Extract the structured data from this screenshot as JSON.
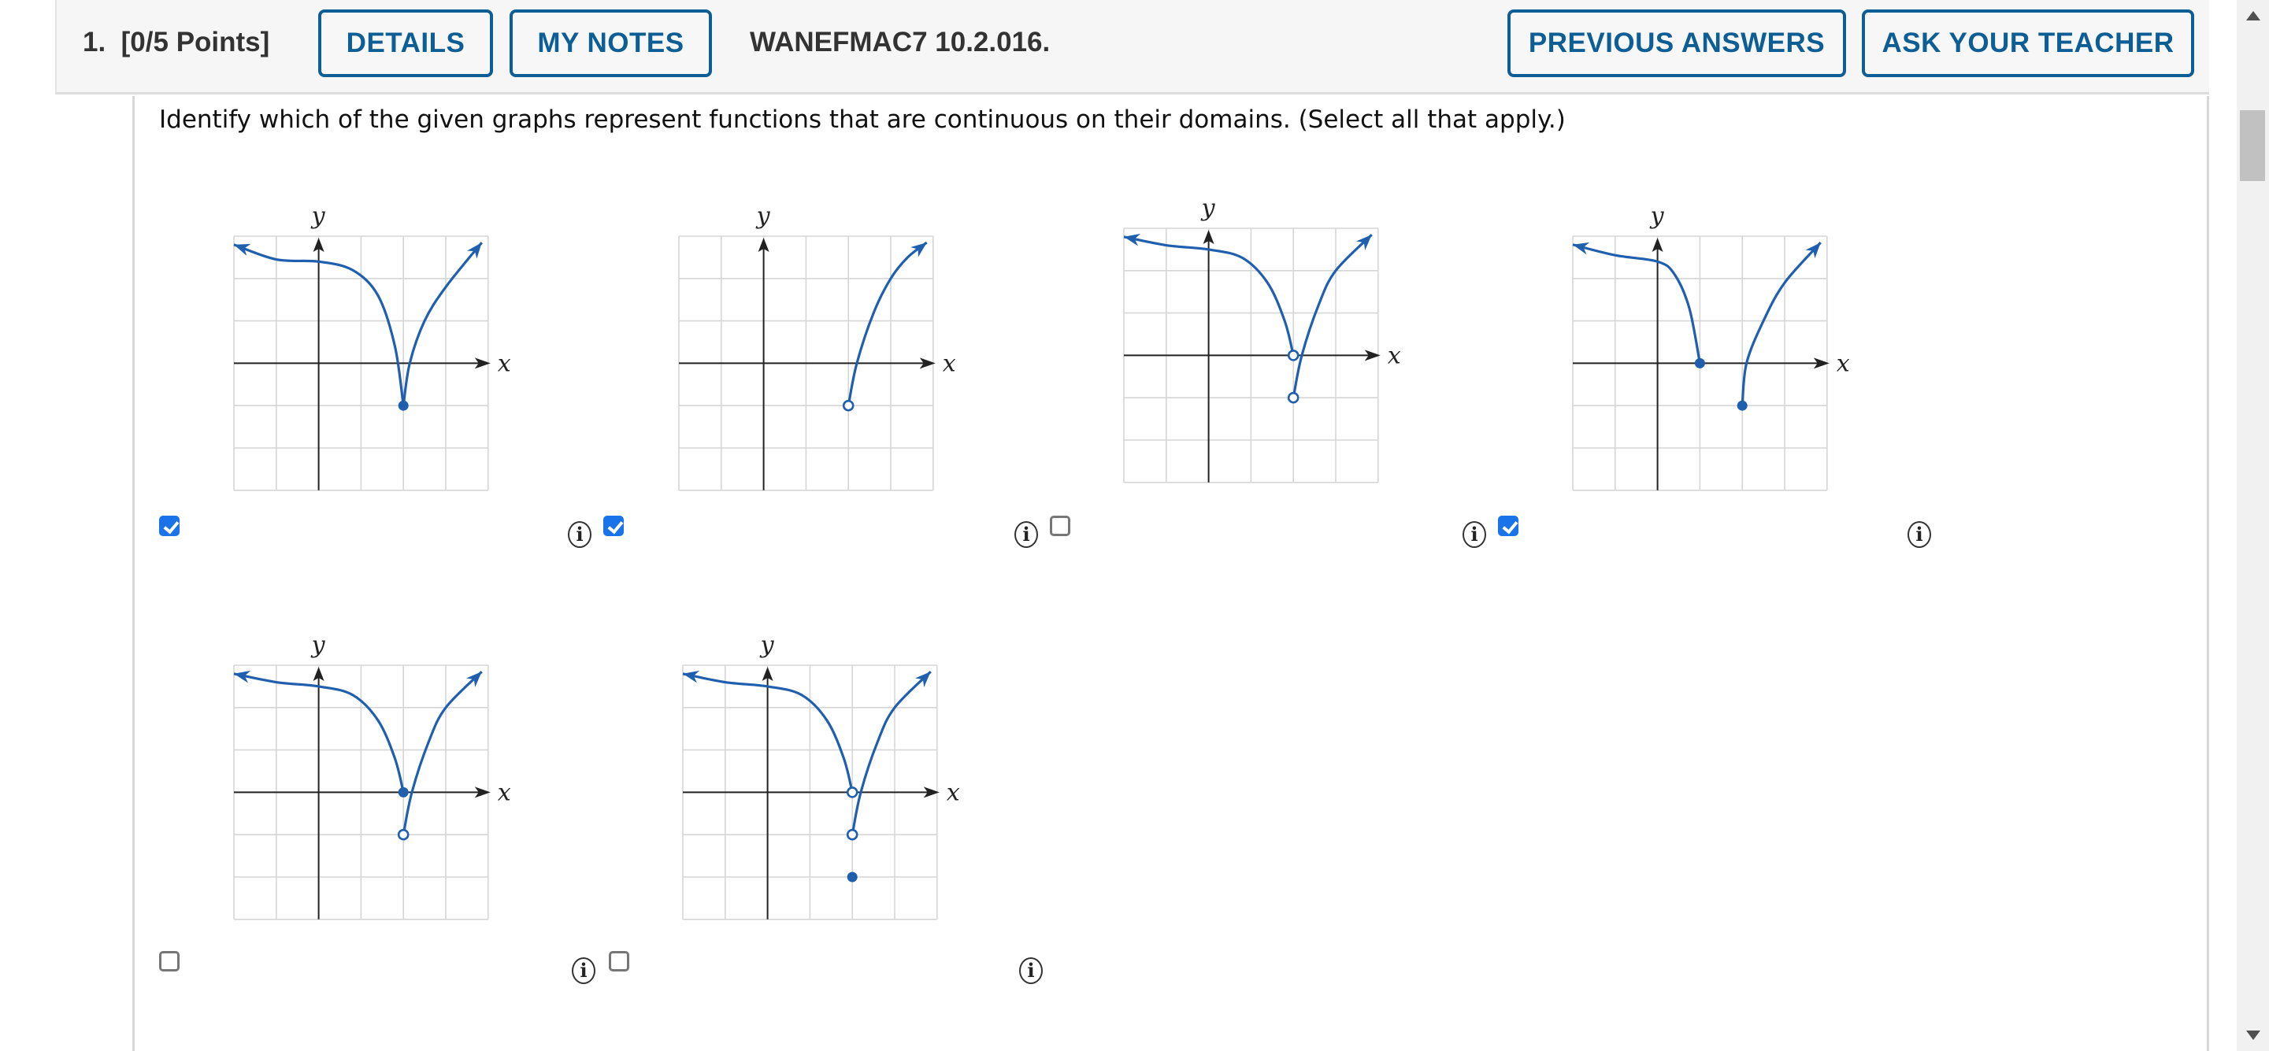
{
  "header": {
    "question_number": "1.",
    "points": "[0/5 Points]",
    "details_label": "DETAILS",
    "my_notes_label": "MY NOTES",
    "problem_code": "WANEFMAC7 10.2.016.",
    "previous_answers_label": "PREVIOUS ANSWERS",
    "ask_teacher_label": "ASK YOUR TEACHER"
  },
  "question": {
    "text": "Identify which of the given graphs represent functions that are continuous on their domains. (Select all that apply.)"
  },
  "colors": {
    "accent": "#0d5e94",
    "curve": "#1f5fae",
    "checkbox_checked": "#1a73e8",
    "grid": "#d6d6d6",
    "axis": "#222222",
    "header_bg": "#f6f6f6"
  },
  "info_icon": "info-circle-icon",
  "chart_data": [
    {
      "type": "line",
      "id": "graph-1",
      "xlabel": "x",
      "ylabel": "y",
      "xlim": [
        -2,
        4
      ],
      "ylim": [
        -3,
        3
      ],
      "grid": true,
      "checked": true,
      "segments": [
        {
          "points": [
            [
              -2,
              2.8
            ],
            [
              -1,
              2.45
            ],
            [
              0,
              2.4
            ],
            [
              0.8,
              2.2
            ],
            [
              1.4,
              1.6
            ],
            [
              1.8,
              0.4
            ],
            [
              2,
              -1
            ]
          ],
          "arrow_start": true,
          "arrow_end": false
        },
        {
          "points": [
            [
              2,
              -1
            ],
            [
              2.15,
              0
            ],
            [
              2.5,
              1.0
            ],
            [
              3,
              1.8
            ],
            [
              3.85,
              2.85
            ]
          ],
          "arrow_start": false,
          "arrow_end": true
        }
      ],
      "closed_points": [
        [
          2,
          -1
        ]
      ],
      "open_points": []
    },
    {
      "type": "line",
      "id": "graph-2",
      "xlabel": "x",
      "ylabel": "y",
      "xlim": [
        -2,
        4
      ],
      "ylim": [
        -3,
        3
      ],
      "grid": true,
      "checked": true,
      "segments": [
        {
          "points": [
            [
              2,
              -1
            ],
            [
              2.2,
              0
            ],
            [
              2.6,
              1.2
            ],
            [
              3,
              2.0
            ],
            [
              3.4,
              2.5
            ],
            [
              3.85,
              2.85
            ]
          ],
          "arrow_start": false,
          "arrow_end": true
        }
      ],
      "closed_points": [],
      "open_points": [
        [
          2,
          -1
        ]
      ]
    },
    {
      "type": "line",
      "id": "graph-3",
      "xlabel": "x",
      "ylabel": "y",
      "xlim": [
        -2,
        4
      ],
      "ylim": [
        -3,
        3
      ],
      "grid": true,
      "checked": false,
      "segments": [
        {
          "points": [
            [
              -2,
              2.8
            ],
            [
              -1,
              2.6
            ],
            [
              0,
              2.5
            ],
            [
              0.8,
              2.3
            ],
            [
              1.4,
              1.7
            ],
            [
              1.8,
              0.8
            ],
            [
              2,
              0
            ]
          ],
          "arrow_start": true,
          "arrow_end": false
        },
        {
          "points": [
            [
              2,
              -1
            ],
            [
              2.2,
              0
            ],
            [
              2.6,
              1.2
            ],
            [
              3,
              2.0
            ],
            [
              3.85,
              2.85
            ]
          ],
          "arrow_start": false,
          "arrow_end": true
        }
      ],
      "closed_points": [],
      "open_points": [
        [
          2,
          0
        ],
        [
          2,
          -1
        ]
      ]
    },
    {
      "type": "line",
      "id": "graph-4",
      "xlabel": "x",
      "ylabel": "y",
      "xlim": [
        -2,
        4
      ],
      "ylim": [
        -3,
        3
      ],
      "grid": true,
      "checked": true,
      "segments": [
        {
          "points": [
            [
              -2,
              2.8
            ],
            [
              -1,
              2.55
            ],
            [
              0,
              2.4
            ],
            [
              0.4,
              2.1
            ],
            [
              0.75,
              1.3
            ],
            [
              1,
              0
            ]
          ],
          "arrow_start": true,
          "arrow_end": false
        },
        {
          "points": [
            [
              2,
              -1
            ],
            [
              2.1,
              0
            ],
            [
              2.5,
              1.0
            ],
            [
              3,
              1.9
            ],
            [
              3.85,
              2.85
            ]
          ],
          "arrow_start": false,
          "arrow_end": true
        }
      ],
      "closed_points": [
        [
          1,
          0
        ],
        [
          2,
          -1
        ]
      ],
      "open_points": []
    },
    {
      "type": "line",
      "id": "graph-5",
      "xlabel": "x",
      "ylabel": "y",
      "xlim": [
        -2,
        4
      ],
      "ylim": [
        -3,
        3
      ],
      "grid": true,
      "checked": false,
      "segments": [
        {
          "points": [
            [
              -2,
              2.8
            ],
            [
              -1,
              2.6
            ],
            [
              0,
              2.5
            ],
            [
              0.8,
              2.3
            ],
            [
              1.4,
              1.7
            ],
            [
              1.8,
              0.8
            ],
            [
              2,
              0
            ]
          ],
          "arrow_start": true,
          "arrow_end": false
        },
        {
          "points": [
            [
              2,
              -1
            ],
            [
              2.2,
              0
            ],
            [
              2.6,
              1.2
            ],
            [
              3,
              2.0
            ],
            [
              3.85,
              2.85
            ]
          ],
          "arrow_start": false,
          "arrow_end": true
        }
      ],
      "closed_points": [
        [
          2,
          0
        ]
      ],
      "open_points": [
        [
          2,
          -1
        ]
      ]
    },
    {
      "type": "line",
      "id": "graph-6",
      "xlabel": "x",
      "ylabel": "y",
      "xlim": [
        -2,
        4
      ],
      "ylim": [
        -3,
        3
      ],
      "grid": true,
      "checked": false,
      "segments": [
        {
          "points": [
            [
              -2,
              2.8
            ],
            [
              -1,
              2.6
            ],
            [
              0,
              2.5
            ],
            [
              0.8,
              2.3
            ],
            [
              1.4,
              1.7
            ],
            [
              1.8,
              0.8
            ],
            [
              2,
              0
            ]
          ],
          "arrow_start": true,
          "arrow_end": false
        },
        {
          "points": [
            [
              2,
              -1
            ],
            [
              2.2,
              0
            ],
            [
              2.6,
              1.2
            ],
            [
              3,
              2.0
            ],
            [
              3.85,
              2.85
            ]
          ],
          "arrow_start": false,
          "arrow_end": true
        }
      ],
      "closed_points": [
        [
          2,
          -2
        ]
      ],
      "open_points": [
        [
          2,
          0
        ],
        [
          2,
          -1
        ]
      ]
    }
  ]
}
